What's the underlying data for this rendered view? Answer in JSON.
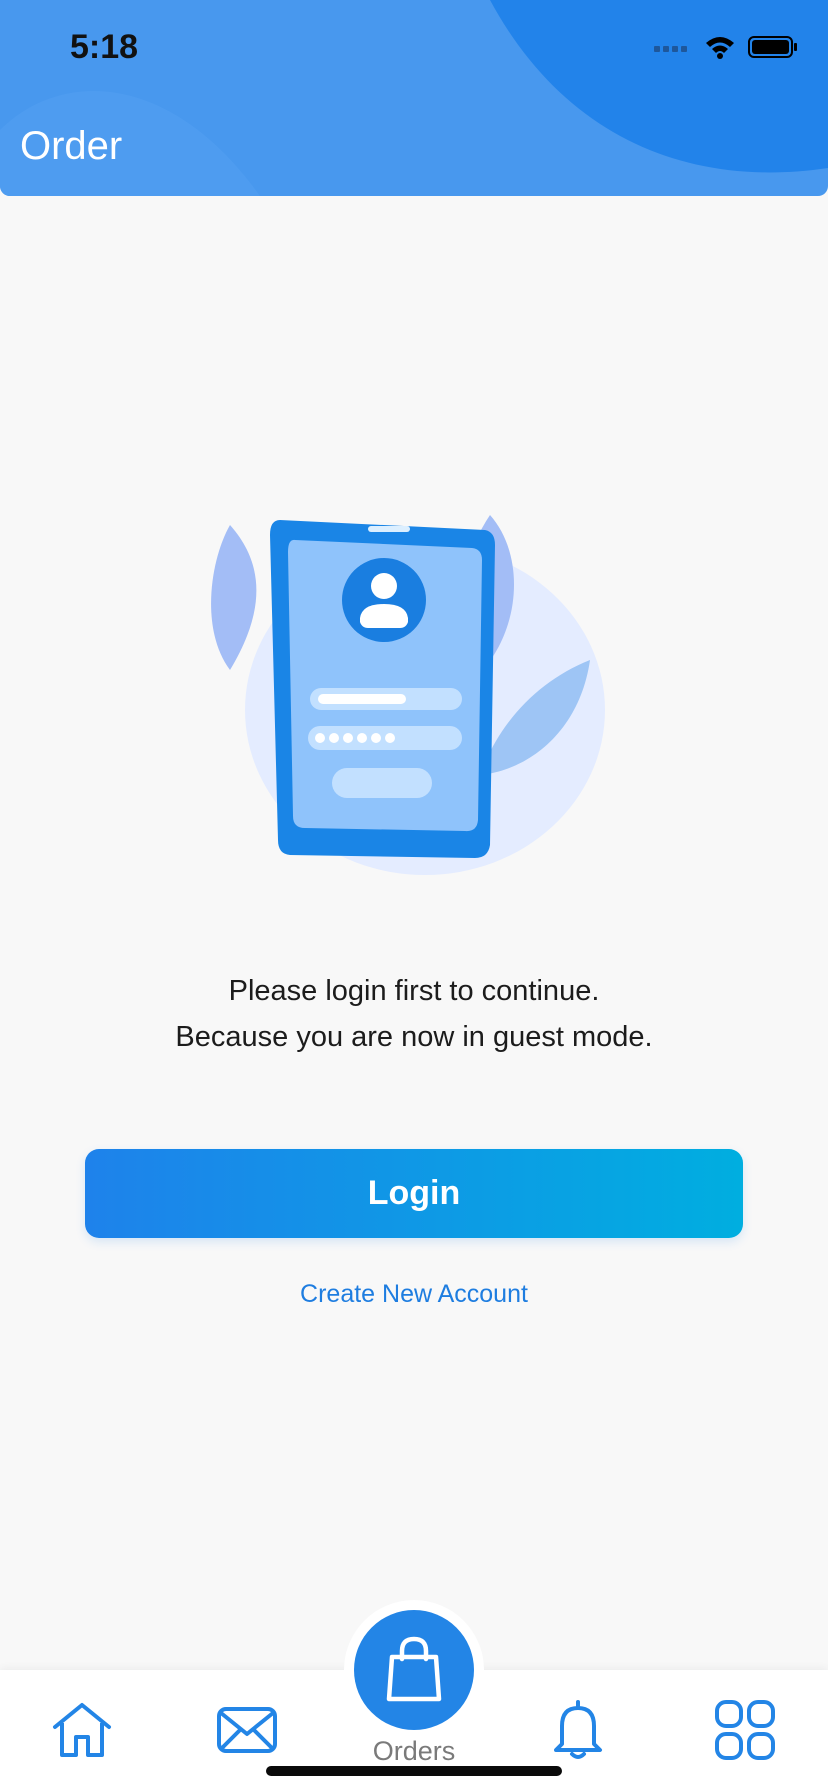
{
  "status_bar": {
    "time": "5:18"
  },
  "header": {
    "title": "Order"
  },
  "message": {
    "line1": "Please login first to continue.",
    "line2": "Because you are now in guest mode."
  },
  "actions": {
    "login_label": "Login",
    "create_account_label": "Create New Account"
  },
  "tab_bar": {
    "center_label": "Orders",
    "icons": [
      "home-icon",
      "mail-icon",
      "shopping-bag-icon",
      "bell-icon",
      "grid-icon"
    ]
  },
  "colors": {
    "primary": "#2385e6",
    "header": "#4898ee",
    "button_gradient_start": "#1e82eb",
    "button_gradient_end": "#00aee0",
    "background": "#f8f8f8"
  }
}
